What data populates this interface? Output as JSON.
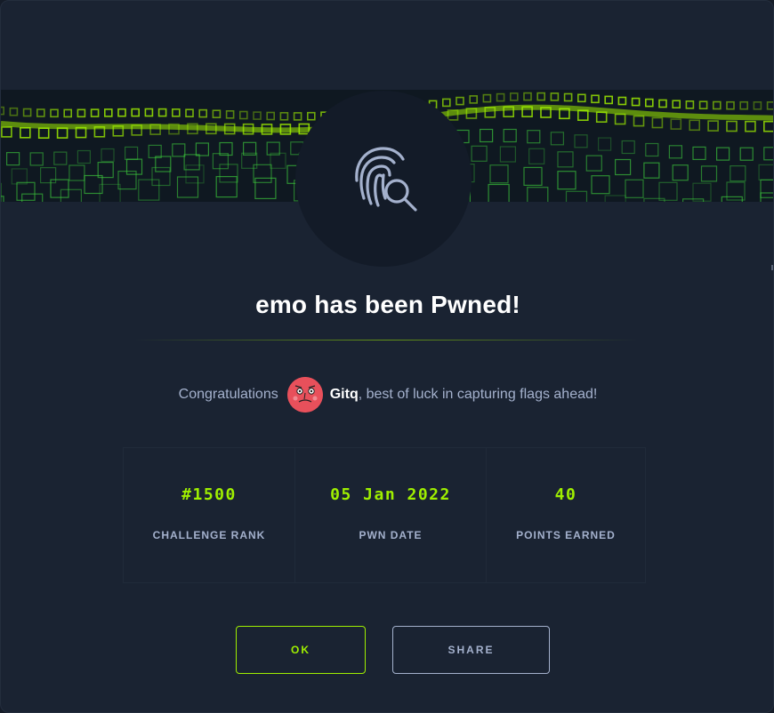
{
  "modal": {
    "title": "emo has been Pwned!",
    "congrats": {
      "prefix": "Congratulations",
      "username": "Gitq",
      "suffix": ", best of luck in capturing flags ahead!"
    },
    "stats": [
      {
        "value": "#1500",
        "label": "CHALLENGE RANK"
      },
      {
        "value": "05 Jan 2022",
        "label": "PWN DATE"
      },
      {
        "value": "40",
        "label": "POINTS EARNED"
      }
    ],
    "buttons": {
      "ok": "OK",
      "share": "SHARE"
    }
  },
  "icons": {
    "badge": "fingerprint-search-icon",
    "avatar": "user-avatar"
  },
  "colors": {
    "accent": "#9fef00",
    "text_muted": "#a4b1cd",
    "background": "#1a2332",
    "avatar": "#e8505b"
  }
}
